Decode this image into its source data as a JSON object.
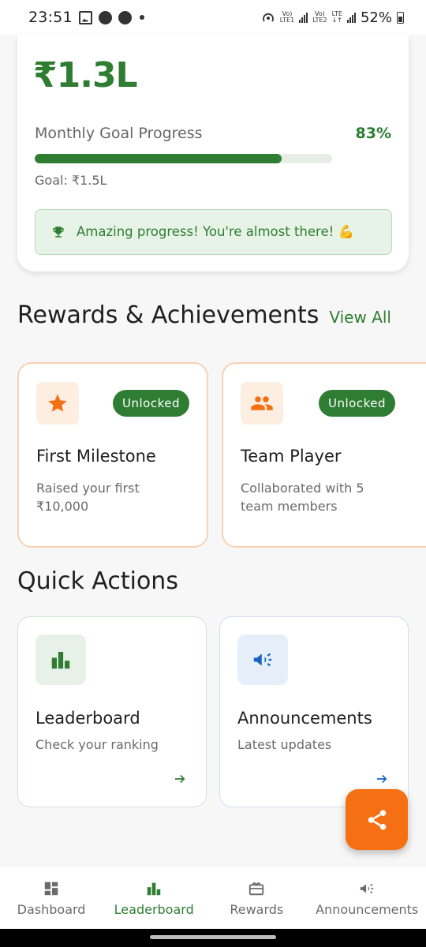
{
  "status_bar": {
    "time": "23:51",
    "net1": "Vo)\nLTE1",
    "net2": "Vo)\nLTE2",
    "lte": "LTE",
    "battery": "52%"
  },
  "goal": {
    "amount": "₹1.3L",
    "label": "Monthly Goal Progress",
    "percent_text": "83%",
    "progress": 0.83,
    "target": "Goal: ₹1.5L",
    "message": "Amazing progress! You're almost there! 💪"
  },
  "rewards": {
    "title": "Rewards & Achievements",
    "view_all": "View All",
    "cards": [
      {
        "icon": "star-icon",
        "badge": "Unlocked",
        "title": "First Milestone",
        "desc": "Raised your first ₹10,000"
      },
      {
        "icon": "group-icon",
        "badge": "Unlocked",
        "title": "Team Player",
        "desc": "Collaborated with 5 team members"
      }
    ]
  },
  "quick_actions": {
    "title": "Quick Actions",
    "cards": [
      {
        "icon": "bar-chart-icon",
        "title": "Leaderboard",
        "sub": "Check your ranking"
      },
      {
        "icon": "megaphone-icon",
        "title": "Announcements",
        "sub": "Latest updates"
      }
    ]
  },
  "nav": {
    "items": [
      {
        "label": "Dashboard",
        "icon": "dashboard-icon"
      },
      {
        "label": "Leaderboard",
        "icon": "bar-chart-icon"
      },
      {
        "label": "Rewards",
        "icon": "gift-icon"
      },
      {
        "label": "Announcements",
        "icon": "megaphone-icon"
      }
    ],
    "active": 1
  },
  "colors": {
    "primary_green": "#2e7d32",
    "accent_orange": "#f57012",
    "blue": "#1565c0"
  }
}
